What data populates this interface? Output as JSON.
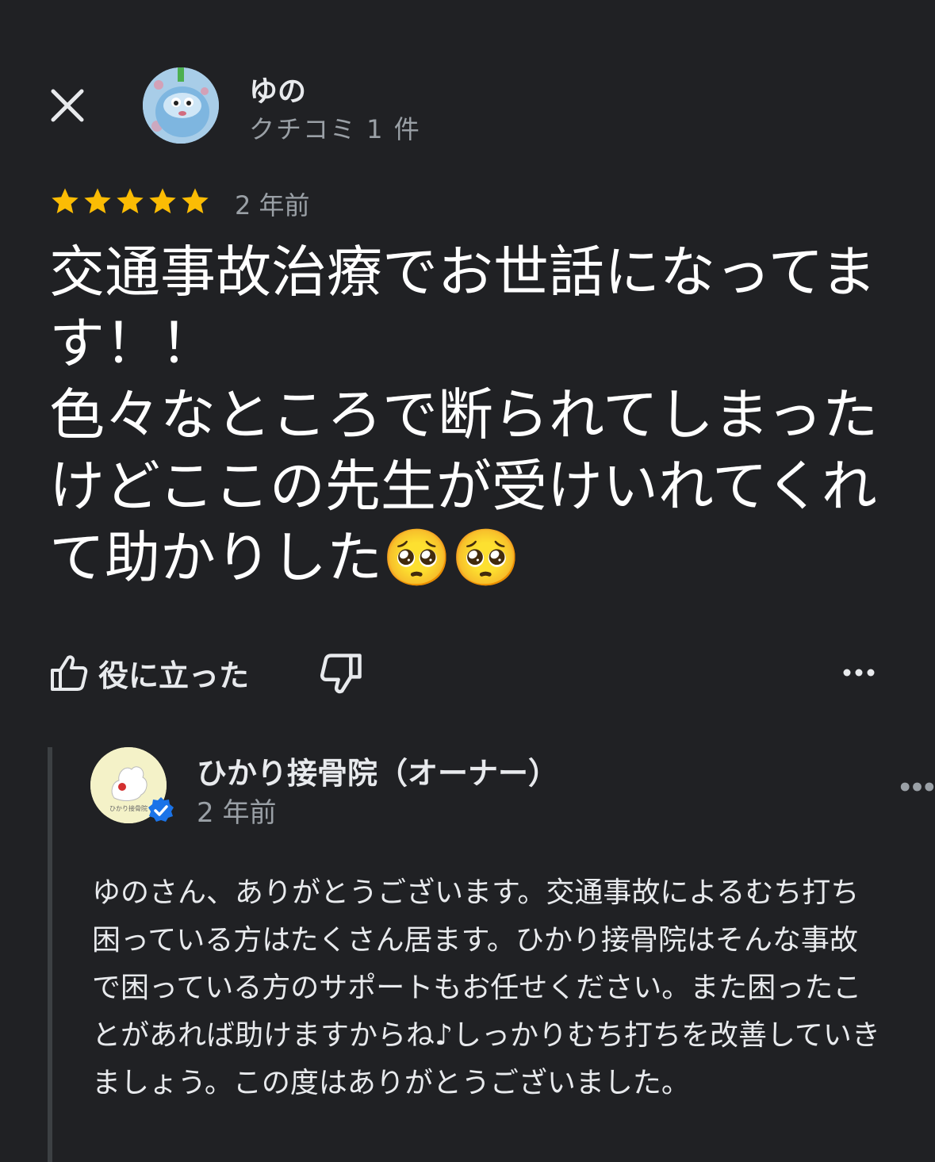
{
  "reviewer": {
    "name": "ゆの",
    "review_count": "クチコミ 1 件"
  },
  "review": {
    "rating": 5,
    "date": "2 年前",
    "text": "交通事故治療でお世話になってます！！\n色々なところで断られてしまったけどここの先生が受けいれてくれて助かりした🥺🥺"
  },
  "actions": {
    "helpful_label": "役に立った"
  },
  "owner_reply": {
    "name": "ひかり接骨院（オーナー）",
    "date": "2 年前",
    "text": "ゆのさん、ありがとうございます。交通事故によるむち打ち困っている方はたくさん居ます。ひかり接骨院はそんな事故で困っている方のサポートもお任せください。また困ったことがあれば助けますからね♪しっかりむち打ちを改善していきましょう。この度はありがとうございました。",
    "logo_text": "ひかり接骨院"
  },
  "colors": {
    "background": "#202124",
    "star": "#fbbc04",
    "secondary_text": "#9aa0a6",
    "verified": "#1a73e8"
  }
}
